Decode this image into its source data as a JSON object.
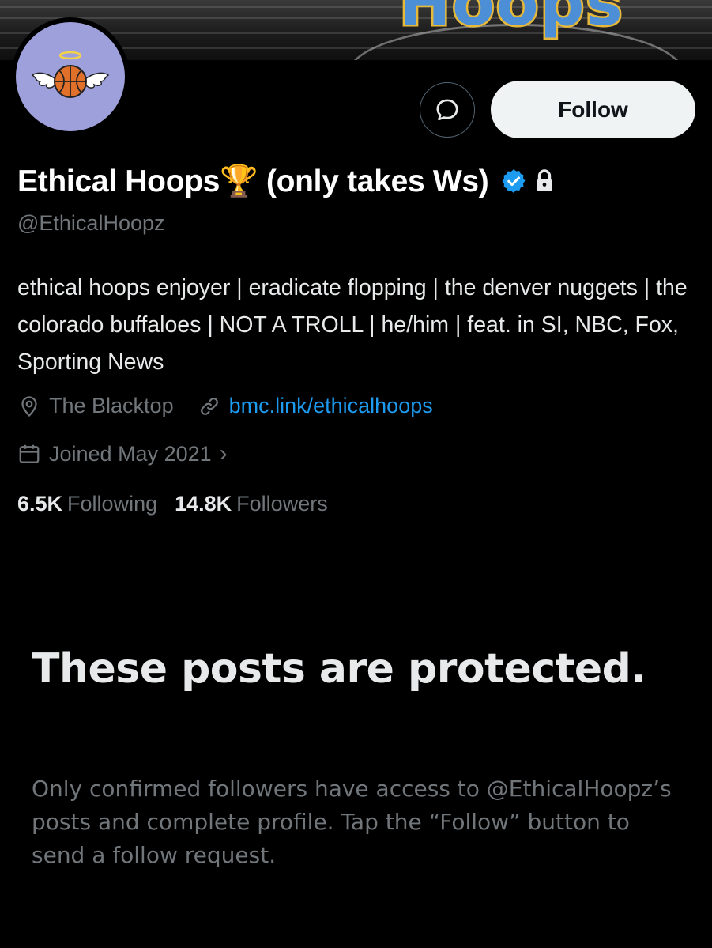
{
  "banner": {
    "title": "Hoops"
  },
  "header": {
    "follow_label": "Follow"
  },
  "profile": {
    "display_name": "Ethical Hoops🏆 (only takes Ws)",
    "handle": "@EthicalHoopz",
    "bio": "ethical hoops enjoyer | eradicate flopping | the denver nuggets | the colorado buffaloes | NOT A TROLL | he/him | feat. in SI, NBC, Fox, Sporting News",
    "location": "The Blacktop",
    "website": "bmc.link/ethicalhoops",
    "joined": "Joined May 2021",
    "joined_chevron": "›",
    "following_count": "6.5K",
    "following_label": "Following",
    "followers_count": "14.8K",
    "followers_label": "Followers"
  },
  "protected_notice": {
    "title": "These posts are protected.",
    "body": "Only confirmed followers have access to @EthicalHoopz’s posts and complete profile. Tap the “Follow” button to send a follow request."
  },
  "colors": {
    "background": "#000000",
    "text_primary": "#e7e9ea",
    "text_secondary": "#71767b",
    "link": "#1d9bf0",
    "verified_badge": "#1d9bf0",
    "follow_button_bg": "#eff3f4",
    "avatar_bg": "#9ea0dc"
  },
  "icons": {
    "message": "message-bubble-icon",
    "verified": "verified-badge-icon",
    "protected": "lock-icon",
    "location": "location-pin-icon",
    "website": "link-icon",
    "joined": "calendar-icon"
  }
}
